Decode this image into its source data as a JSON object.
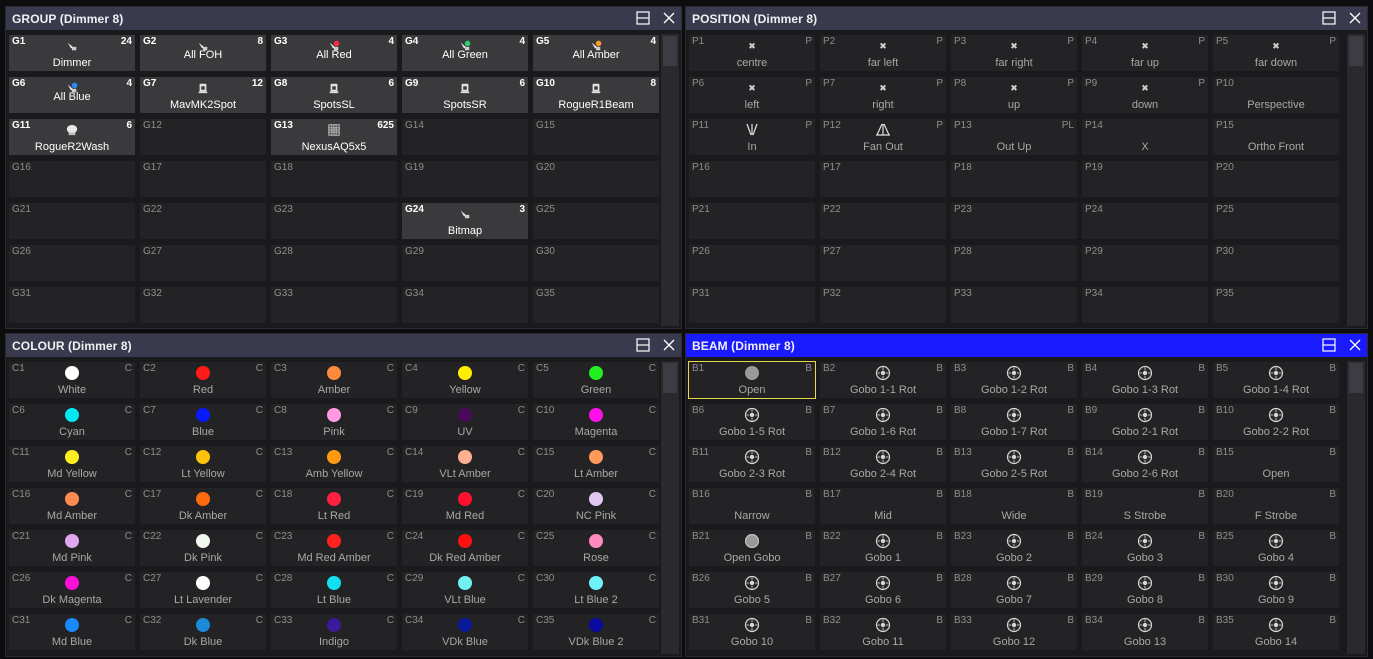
{
  "group": {
    "title": "GROUP (Dimmer 8)",
    "cells": [
      {
        "num": "G1",
        "count": "24",
        "label": "Dimmer",
        "icon": "spot-fixture-icon",
        "filled": true
      },
      {
        "num": "G2",
        "count": "8",
        "label": "All FOH",
        "icon": "spot-fixture-icon",
        "filled": true,
        "mid": true
      },
      {
        "num": "G3",
        "count": "4",
        "label": "All Red",
        "icon": "spot-fixture-icon",
        "filled": true,
        "mid": true,
        "color": "#ff2a3c"
      },
      {
        "num": "G4",
        "count": "4",
        "label": "All Green",
        "icon": "spot-fixture-icon",
        "filled": true,
        "mid": true,
        "color": "#2ad06a"
      },
      {
        "num": "G5",
        "count": "4",
        "label": "All Amber",
        "icon": "spot-fixture-icon",
        "filled": true,
        "mid": true,
        "color": "#ff9a20"
      },
      {
        "num": "G6",
        "count": "4",
        "label": "All Blue",
        "icon": "spot-fixture-icon",
        "filled": true,
        "mid": true,
        "color": "#2a8cff"
      },
      {
        "num": "G7",
        "count": "12",
        "label": "MavMK2Spot",
        "icon": "moving-head-icon",
        "filled": true
      },
      {
        "num": "G8",
        "count": "6",
        "label": "SpotsSL",
        "icon": "moving-head-icon",
        "filled": true
      },
      {
        "num": "G9",
        "count": "6",
        "label": "SpotsSR",
        "icon": "moving-head-icon",
        "filled": true
      },
      {
        "num": "G10",
        "count": "8",
        "label": "RogueR1Beam",
        "icon": "moving-head-icon",
        "filled": true
      },
      {
        "num": "G11",
        "count": "6",
        "label": "RogueR2Wash",
        "icon": "wash-fixture-icon",
        "filled": true
      },
      {
        "num": "G12",
        "label": ""
      },
      {
        "num": "G13",
        "count": "625",
        "label": "NexusAQ5x5",
        "icon": "matrix-panel-icon",
        "filled": true
      },
      {
        "num": "G14",
        "label": ""
      },
      {
        "num": "G15",
        "label": ""
      },
      {
        "num": "G16",
        "label": ""
      },
      {
        "num": "G17",
        "label": ""
      },
      {
        "num": "G18",
        "label": ""
      },
      {
        "num": "G19",
        "label": ""
      },
      {
        "num": "G20",
        "label": ""
      },
      {
        "num": "G21",
        "label": ""
      },
      {
        "num": "G22",
        "label": ""
      },
      {
        "num": "G23",
        "label": ""
      },
      {
        "num": "G24",
        "count": "3",
        "label": "Bitmap",
        "icon": "spot-fixture-icon",
        "filled": true
      },
      {
        "num": "G25",
        "label": ""
      },
      {
        "num": "G26",
        "label": ""
      },
      {
        "num": "G27",
        "label": ""
      },
      {
        "num": "G28",
        "label": ""
      },
      {
        "num": "G29",
        "label": ""
      },
      {
        "num": "G30",
        "label": ""
      },
      {
        "num": "G31",
        "label": ""
      },
      {
        "num": "G32",
        "label": ""
      },
      {
        "num": "G33",
        "label": ""
      },
      {
        "num": "G34",
        "label": ""
      },
      {
        "num": "G35",
        "label": ""
      }
    ]
  },
  "position": {
    "title": "POSITION (Dimmer 8)",
    "cells": [
      {
        "num": "P1",
        "tag": "P",
        "label": "centre",
        "icon": "x-mark-icon"
      },
      {
        "num": "P2",
        "tag": "P",
        "label": "far left",
        "icon": "x-mark-icon"
      },
      {
        "num": "P3",
        "tag": "P",
        "label": "far right",
        "icon": "x-mark-icon"
      },
      {
        "num": "P4",
        "tag": "P",
        "label": "far up",
        "icon": "x-mark-icon"
      },
      {
        "num": "P5",
        "tag": "P",
        "label": "far down",
        "icon": "x-mark-icon"
      },
      {
        "num": "P6",
        "tag": "P",
        "label": "left",
        "icon": "x-mark-icon"
      },
      {
        "num": "P7",
        "tag": "P",
        "label": "right",
        "icon": "x-mark-icon"
      },
      {
        "num": "P8",
        "tag": "P",
        "label": "up",
        "icon": "x-mark-icon"
      },
      {
        "num": "P9",
        "tag": "P",
        "label": "down",
        "icon": "x-mark-icon"
      },
      {
        "num": "P10",
        "tag": "",
        "label": "Perspective"
      },
      {
        "num": "P11",
        "tag": "P",
        "label": "In",
        "icon": "fan-in-icon"
      },
      {
        "num": "P12",
        "tag": "P",
        "label": "Fan Out",
        "icon": "fan-out-icon"
      },
      {
        "num": "P13",
        "tag": "PL",
        "label": "Out Up"
      },
      {
        "num": "P14",
        "tag": "",
        "label": "X"
      },
      {
        "num": "P15",
        "tag": "",
        "label": "Ortho Front"
      },
      {
        "num": "P16",
        "label": ""
      },
      {
        "num": "P17",
        "label": ""
      },
      {
        "num": "P18",
        "label": ""
      },
      {
        "num": "P19",
        "label": ""
      },
      {
        "num": "P20",
        "label": ""
      },
      {
        "num": "P21",
        "label": ""
      },
      {
        "num": "P22",
        "label": ""
      },
      {
        "num": "P23",
        "label": ""
      },
      {
        "num": "P24",
        "label": ""
      },
      {
        "num": "P25",
        "label": ""
      },
      {
        "num": "P26",
        "label": ""
      },
      {
        "num": "P27",
        "label": ""
      },
      {
        "num": "P28",
        "label": ""
      },
      {
        "num": "P29",
        "label": ""
      },
      {
        "num": "P30",
        "label": ""
      },
      {
        "num": "P31",
        "label": ""
      },
      {
        "num": "P32",
        "label": ""
      },
      {
        "num": "P33",
        "label": ""
      },
      {
        "num": "P34",
        "label": ""
      },
      {
        "num": "P35",
        "label": ""
      }
    ]
  },
  "colour": {
    "title": "COLOUR (Dimmer 8)",
    "cells": [
      {
        "num": "C1",
        "tag": "C",
        "label": "White",
        "color": "#ffffff"
      },
      {
        "num": "C2",
        "tag": "C",
        "label": "Red",
        "color": "#ff1a1a"
      },
      {
        "num": "C3",
        "tag": "C",
        "label": "Amber",
        "color": "#ff8a3c"
      },
      {
        "num": "C4",
        "tag": "C",
        "label": "Yellow",
        "color": "#ffee00"
      },
      {
        "num": "C5",
        "tag": "C",
        "label": "Green",
        "color": "#22ee22"
      },
      {
        "num": "C6",
        "tag": "C",
        "label": "Cyan",
        "color": "#00e8f0"
      },
      {
        "num": "C7",
        "tag": "C",
        "label": "Blue",
        "color": "#0a1aff"
      },
      {
        "num": "C8",
        "tag": "C",
        "label": "Pink",
        "color": "#ff9ae0"
      },
      {
        "num": "C9",
        "tag": "C",
        "label": "UV",
        "color": "#4a0a5a"
      },
      {
        "num": "C10",
        "tag": "C",
        "label": "Magenta",
        "color": "#ff10e8"
      },
      {
        "num": "C11",
        "tag": "C",
        "label": "Md Yellow",
        "color": "#ffee22"
      },
      {
        "num": "C12",
        "tag": "C",
        "label": "Lt Yellow",
        "color": "#ffc20a"
      },
      {
        "num": "C13",
        "tag": "C",
        "label": "Amb Yellow",
        "color": "#ff9a10"
      },
      {
        "num": "C14",
        "tag": "C",
        "label": "VLt Amber",
        "color": "#ffb090"
      },
      {
        "num": "C15",
        "tag": "C",
        "label": "Lt Amber",
        "color": "#ff9a5a"
      },
      {
        "num": "C16",
        "tag": "C",
        "label": "Md Amber",
        "color": "#ff8a50"
      },
      {
        "num": "C17",
        "tag": "C",
        "label": "Dk Amber",
        "color": "#ff6a10"
      },
      {
        "num": "C18",
        "tag": "C",
        "label": "Lt Red",
        "color": "#ff2040"
      },
      {
        "num": "C19",
        "tag": "C",
        "label": "Md Red",
        "color": "#ff1030"
      },
      {
        "num": "C20",
        "tag": "C",
        "label": "NC Pink",
        "color": "#e0c8f0"
      },
      {
        "num": "C21",
        "tag": "C",
        "label": "Md Pink",
        "color": "#e0a8f0"
      },
      {
        "num": "C22",
        "tag": "C",
        "label": "Dk Pink",
        "color": "#f0f8f0"
      },
      {
        "num": "C23",
        "tag": "C",
        "label": "Md Red Amber",
        "color": "#ff2020"
      },
      {
        "num": "C24",
        "tag": "C",
        "label": "Dk Red Amber",
        "color": "#ff1010"
      },
      {
        "num": "C25",
        "tag": "C",
        "label": "Rose",
        "color": "#ff8ac0"
      },
      {
        "num": "C26",
        "tag": "C",
        "label": "Dk Magenta",
        "color": "#ff10d8"
      },
      {
        "num": "C27",
        "tag": "C",
        "label": "Lt Lavender",
        "color": "#ffffff"
      },
      {
        "num": "C28",
        "tag": "C",
        "label": "Lt Blue",
        "color": "#10e0f0"
      },
      {
        "num": "C29",
        "tag": "C",
        "label": "VLt Blue",
        "color": "#70f0f0"
      },
      {
        "num": "C30",
        "tag": "C",
        "label": "Lt Blue 2",
        "color": "#70f0f8"
      },
      {
        "num": "C31",
        "tag": "C",
        "label": "Md Blue",
        "color": "#1a8aff"
      },
      {
        "num": "C32",
        "tag": "C",
        "label": "Dk Blue",
        "color": "#1a8ad8"
      },
      {
        "num": "C33",
        "tag": "C",
        "label": "Indigo",
        "color": "#3a1a9a"
      },
      {
        "num": "C34",
        "tag": "C",
        "label": "VDk Blue",
        "color": "#0a1a9a"
      },
      {
        "num": "C35",
        "tag": "C",
        "label": "VDk Blue 2",
        "color": "#0a0aa0"
      }
    ]
  },
  "beam": {
    "title": "BEAM (Dimmer 8)",
    "cells": [
      {
        "num": "B1",
        "tag": "B",
        "label": "Open",
        "selected": true
      },
      {
        "num": "B2",
        "tag": "B",
        "label": "Gobo 1-1 Rot",
        "icon": "gobo-icon"
      },
      {
        "num": "B3",
        "tag": "B",
        "label": "Gobo 1-2 Rot",
        "icon": "gobo-icon"
      },
      {
        "num": "B4",
        "tag": "B",
        "label": "Gobo 1-3 Rot",
        "icon": "gobo-icon"
      },
      {
        "num": "B5",
        "tag": "B",
        "label": "Gobo 1-4 Rot",
        "icon": "gobo-icon"
      },
      {
        "num": "B6",
        "tag": "B",
        "label": "Gobo 1-5 Rot",
        "icon": "gobo-icon"
      },
      {
        "num": "B7",
        "tag": "B",
        "label": "Gobo 1-6 Rot",
        "icon": "gobo-icon"
      },
      {
        "num": "B8",
        "tag": "B",
        "label": "Gobo 1-7 Rot",
        "icon": "gobo-icon"
      },
      {
        "num": "B9",
        "tag": "B",
        "label": "Gobo 2-1 Rot",
        "icon": "gobo-icon"
      },
      {
        "num": "B10",
        "tag": "B",
        "label": "Gobo 2-2 Rot",
        "icon": "gobo-icon"
      },
      {
        "num": "B11",
        "tag": "B",
        "label": "Gobo 2-3 Rot",
        "icon": "gobo-icon"
      },
      {
        "num": "B12",
        "tag": "B",
        "label": "Gobo 2-4 Rot",
        "icon": "gobo-icon"
      },
      {
        "num": "B13",
        "tag": "B",
        "label": "Gobo 2-5 Rot",
        "icon": "gobo-icon"
      },
      {
        "num": "B14",
        "tag": "B",
        "label": "Gobo 2-6 Rot",
        "icon": "gobo-icon"
      },
      {
        "num": "B15",
        "tag": "B",
        "label": "Open"
      },
      {
        "num": "B16",
        "tag": "B",
        "label": "Narrow"
      },
      {
        "num": "B17",
        "tag": "B",
        "label": "Mid"
      },
      {
        "num": "B18",
        "tag": "B",
        "label": "Wide"
      },
      {
        "num": "B19",
        "tag": "B",
        "label": "S Strobe"
      },
      {
        "num": "B20",
        "tag": "B",
        "label": "F Strobe"
      },
      {
        "num": "B21",
        "tag": "B",
        "label": "Open Gobo",
        "icon": "open-gobo-icon"
      },
      {
        "num": "B22",
        "tag": "B",
        "label": "Gobo 1",
        "icon": "gobo-icon"
      },
      {
        "num": "B23",
        "tag": "B",
        "label": "Gobo 2",
        "icon": "gobo-icon"
      },
      {
        "num": "B24",
        "tag": "B",
        "label": "Gobo 3",
        "icon": "gobo-icon"
      },
      {
        "num": "B25",
        "tag": "B",
        "label": "Gobo 4",
        "icon": "gobo-icon"
      },
      {
        "num": "B26",
        "tag": "B",
        "label": "Gobo 5",
        "icon": "gobo-icon"
      },
      {
        "num": "B27",
        "tag": "B",
        "label": "Gobo 6",
        "icon": "gobo-icon"
      },
      {
        "num": "B28",
        "tag": "B",
        "label": "Gobo 7",
        "icon": "gobo-icon"
      },
      {
        "num": "B29",
        "tag": "B",
        "label": "Gobo 8",
        "icon": "gobo-icon"
      },
      {
        "num": "B30",
        "tag": "B",
        "label": "Gobo 9",
        "icon": "gobo-icon"
      },
      {
        "num": "B31",
        "tag": "B",
        "label": "Gobo 10",
        "icon": "gobo-icon"
      },
      {
        "num": "B32",
        "tag": "B",
        "label": "Gobo 11",
        "icon": "gobo-icon"
      },
      {
        "num": "B33",
        "tag": "B",
        "label": "Gobo 12",
        "icon": "gobo-icon"
      },
      {
        "num": "B34",
        "tag": "B",
        "label": "Gobo 13",
        "icon": "gobo-icon"
      },
      {
        "num": "B35",
        "tag": "B",
        "label": "Gobo 14",
        "icon": "gobo-icon"
      }
    ]
  }
}
